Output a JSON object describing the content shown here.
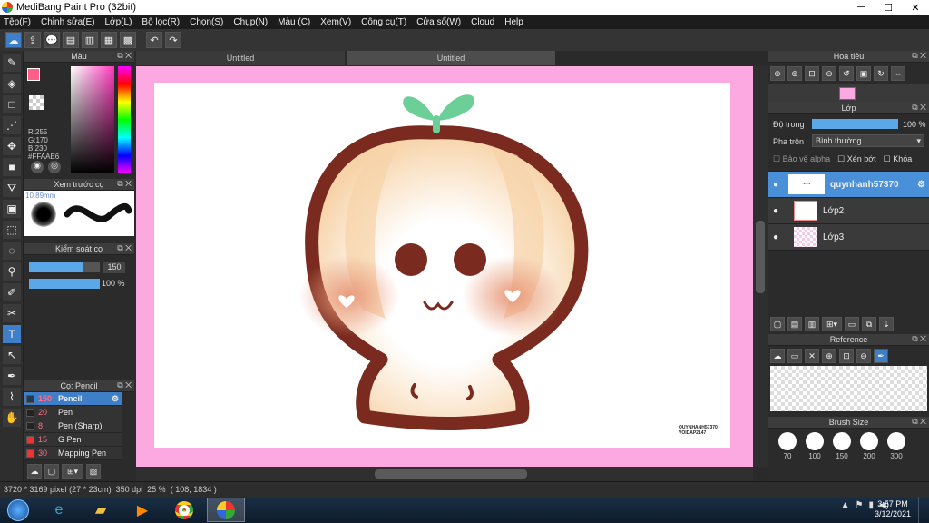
{
  "app": {
    "title": "MediBang Paint Pro (32bit)"
  },
  "menu": [
    "Tệp(F)",
    "Chỉnh sửa(E)",
    "Lớp(L)",
    "Bộ lọc(R)",
    "Chọn(S)",
    "Chụp(N)",
    "Màu (C)",
    "Xem(V)",
    "Công cụ(T)",
    "Cửa sổ(W)",
    "Cloud",
    "Help"
  ],
  "tabs": [
    "Untitled",
    "Untitled"
  ],
  "color_panel": {
    "title": "Màu",
    "r": "R:255",
    "g": "G:170",
    "b": "B:230",
    "hex": "#FFAAE6"
  },
  "brush_preview": {
    "title": "Xem trước cọ",
    "size": "10.89mm"
  },
  "brush_control": {
    "title": "Kiểm soát cọ",
    "size": "150",
    "opacity": "100 %",
    "size_level": 0.75,
    "opacity_level": 1.0
  },
  "brush_list": {
    "title": "Cọ: Pencil",
    "items": [
      {
        "size": "150",
        "name": "Pencil",
        "color": "#1e3a5a"
      },
      {
        "size": "20",
        "name": "Pen",
        "color": "#222"
      },
      {
        "size": "8",
        "name": "Pen (Sharp)",
        "color": "#222"
      },
      {
        "size": "15",
        "name": "G Pen",
        "color": "#e33"
      },
      {
        "size": "30",
        "name": "Mapping Pen",
        "color": "#e33"
      }
    ]
  },
  "navigator": {
    "title": "Hoa tiêu"
  },
  "layers": {
    "title": "Lớp",
    "opacity_label": "Độ trong",
    "opacity_value": "100 %",
    "blend_label": "Pha trộn",
    "blend_value": "Bình thường",
    "protect_alpha": "Bảo vệ alpha",
    "clipping": "Xén bớt",
    "lock": "Khóa",
    "opacity_level": 1.0,
    "items": [
      {
        "name": "quynhanh57370"
      },
      {
        "name": "Lớp2"
      },
      {
        "name": "Lớp3"
      }
    ]
  },
  "reference": {
    "title": "Reference"
  },
  "brush_size": {
    "title": "Brush Size",
    "sizes": [
      "70",
      "100",
      "150",
      "200",
      "300"
    ]
  },
  "watermark": [
    "QUYNHANH57370",
    "VOIDAP2147"
  ],
  "status": {
    "dimensions": "3720 * 3169 pixel",
    "physical": "(27 * 23cm)",
    "dpi": "350 dpi",
    "zoom": "25 %",
    "coords": "( 108, 1834 )"
  },
  "taskbar": {
    "time": "3:57 PM",
    "date": "3/12/2021"
  }
}
